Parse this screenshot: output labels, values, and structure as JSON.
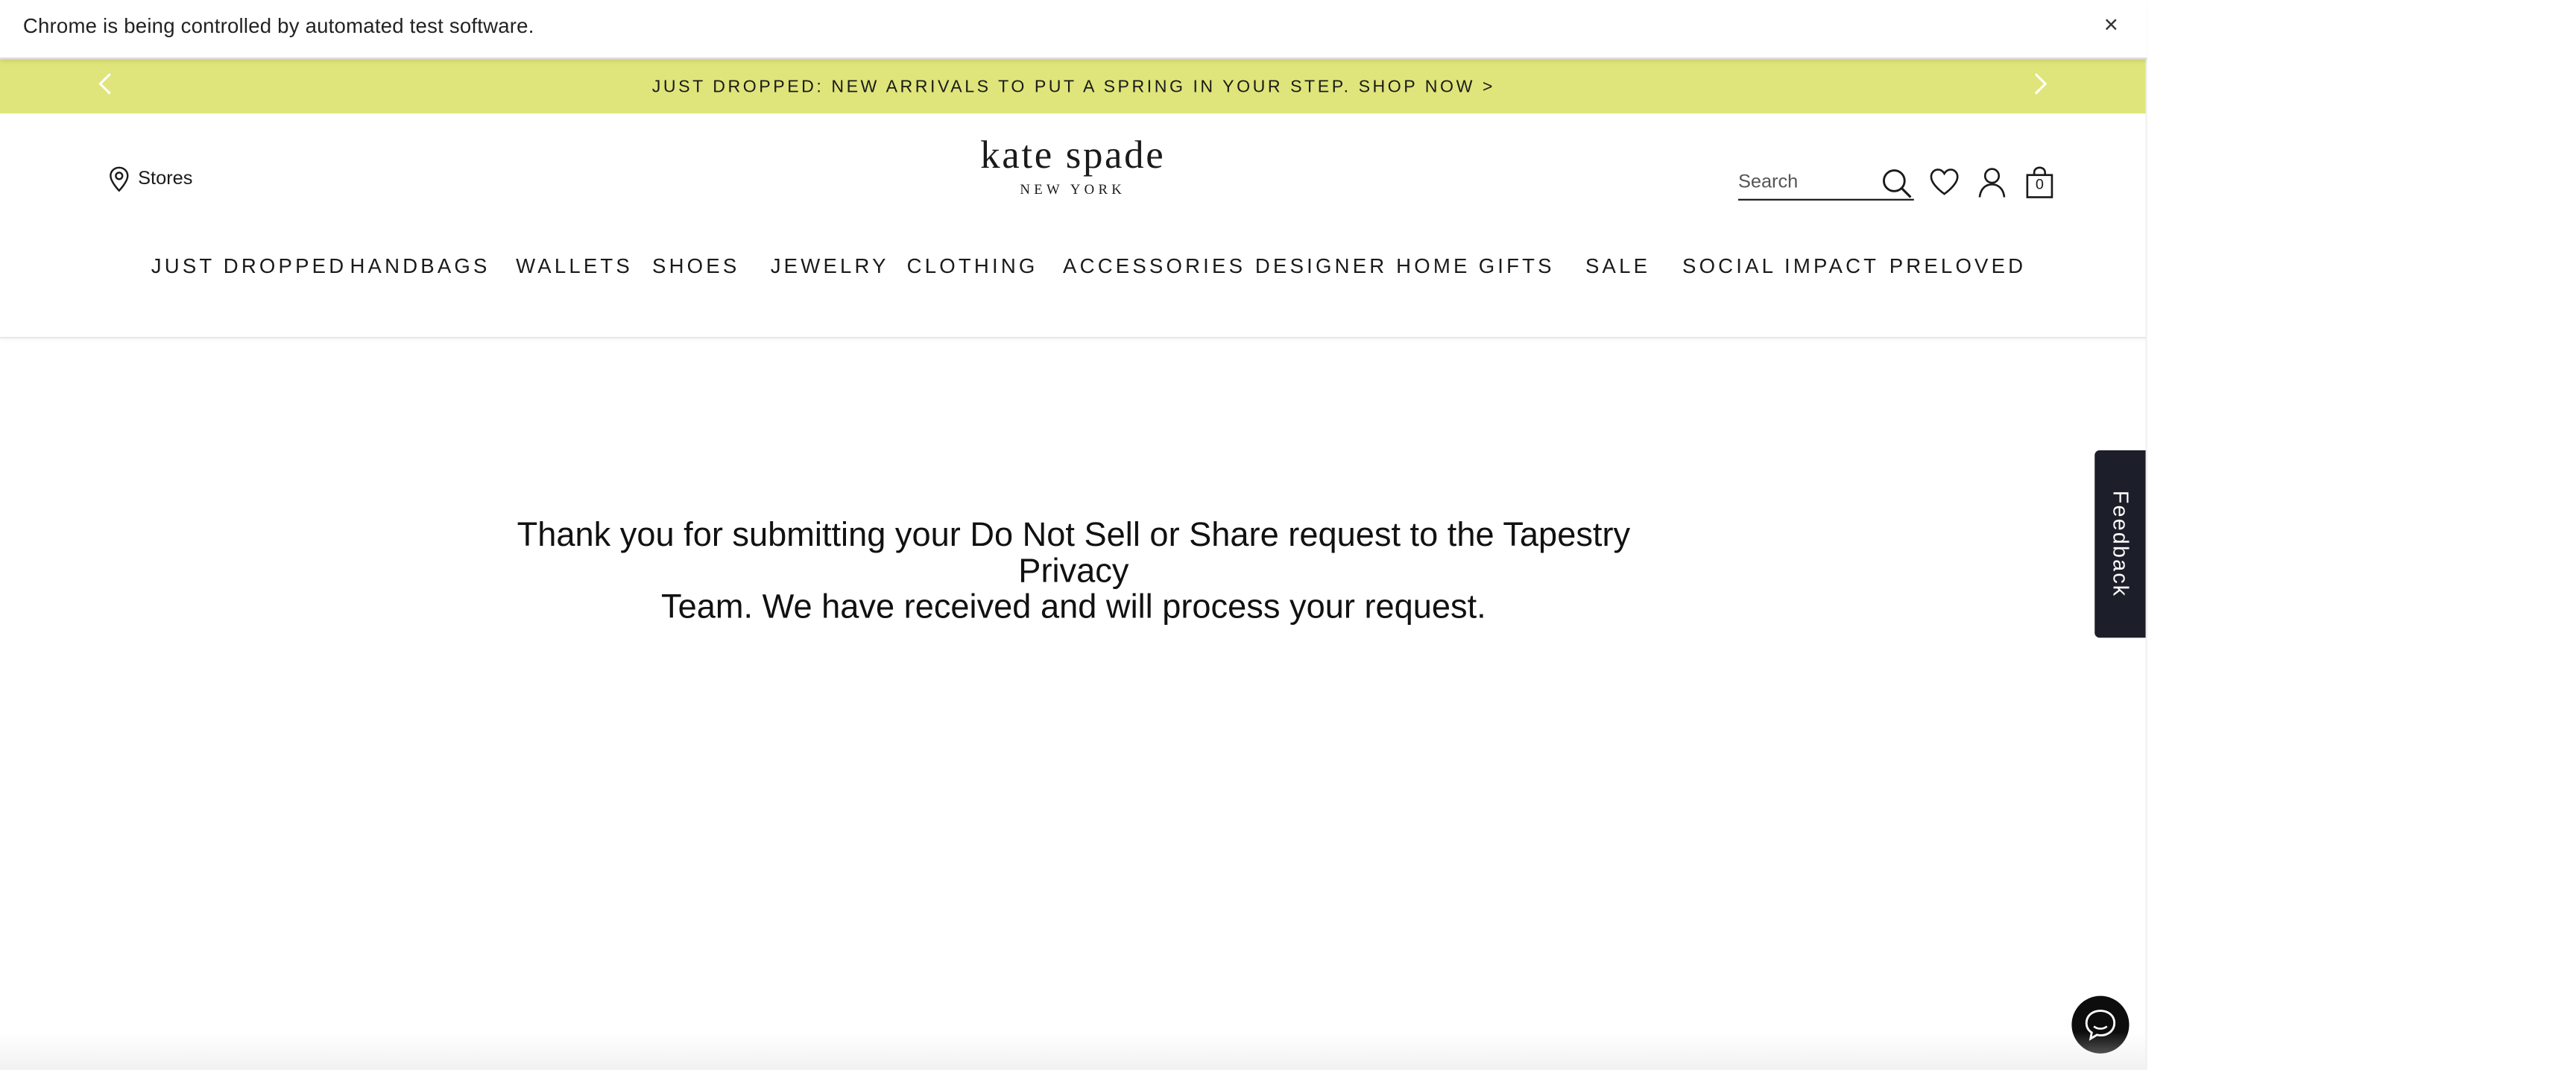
{
  "browser": {
    "infobar_text": "Chrome is being controlled by automated test software.",
    "infobar_close": "×"
  },
  "promo": {
    "text": "JUST DROPPED: NEW ARRIVALS TO PUT A SPRING IN YOUR STEP. SHOP NOW >",
    "background": "#dfe57a",
    "prev_icon": "chevron-left-icon",
    "next_icon": "chevron-right-icon"
  },
  "header": {
    "stores_label": "Stores",
    "logo_main": "kate spade",
    "logo_sub": "NEW YORK",
    "search_placeholder": "Search",
    "bag_count": "0"
  },
  "nav": {
    "items": [
      "JUST DROPPED",
      "HANDBAGS",
      "WALLETS",
      "SHOES",
      "JEWELRY",
      "CLOTHING",
      "ACCESSORIES",
      "DESIGNER HOME",
      "GIFTS",
      "SALE",
      "SOCIAL IMPACT",
      "PRELOVED"
    ]
  },
  "main": {
    "message_line1": "Thank you for submitting your Do Not Sell or Share request to the Tapestry Privacy",
    "message_line2": "Team. We have received and will process your request."
  },
  "widgets": {
    "feedback_label": "Feedback",
    "feedback_color": "#1c1f2a",
    "chat_icon": "chat-bubble-icon"
  }
}
